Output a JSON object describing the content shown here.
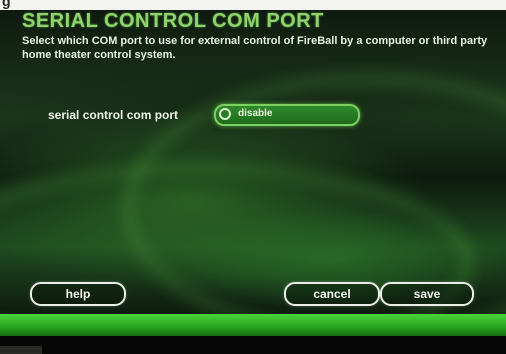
{
  "top_strip": {
    "cropped_text": "g"
  },
  "screen": {
    "title": "SERIAL CONTROL COM PORT",
    "description": "Select which COM port to use for external control of FireBall by a computer or third party home theater control system."
  },
  "setting": {
    "label": "serial control com port",
    "value": "disable"
  },
  "buttons": {
    "help": "help",
    "cancel": "cancel",
    "save": "save"
  },
  "colors": {
    "title_green": "#8fd36a",
    "accent_green": "#2f8a2a",
    "bottom_glow": "#49d63a"
  }
}
